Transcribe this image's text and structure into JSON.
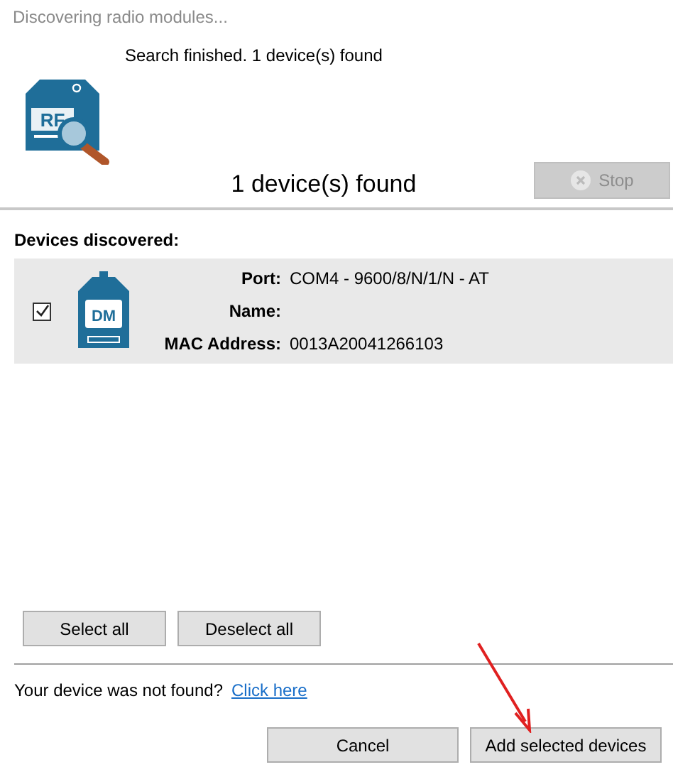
{
  "window": {
    "title": "Discovering radio modules..."
  },
  "status": "Search finished. 1 device(s) found",
  "header_icon_label": "RF",
  "summary": "1 device(s) found",
  "stop_button": {
    "label": "Stop",
    "disabled": true
  },
  "devices_heading": "Devices discovered:",
  "devices": [
    {
      "checked": true,
      "icon_label": "DM",
      "fields": [
        {
          "label": "Port:",
          "value": "COM4 - 9600/8/N/1/N - AT"
        },
        {
          "label": "Name:"
        },
        {
          "label": "MAC Address:",
          "value": "0013A20041266103"
        }
      ]
    }
  ],
  "selection_buttons": [
    "Select all",
    "Deselect all"
  ],
  "not_found": {
    "text": "Your device was not found?",
    "link": "Click here"
  },
  "buttons": [
    "Cancel",
    "Add selected devices"
  ]
}
